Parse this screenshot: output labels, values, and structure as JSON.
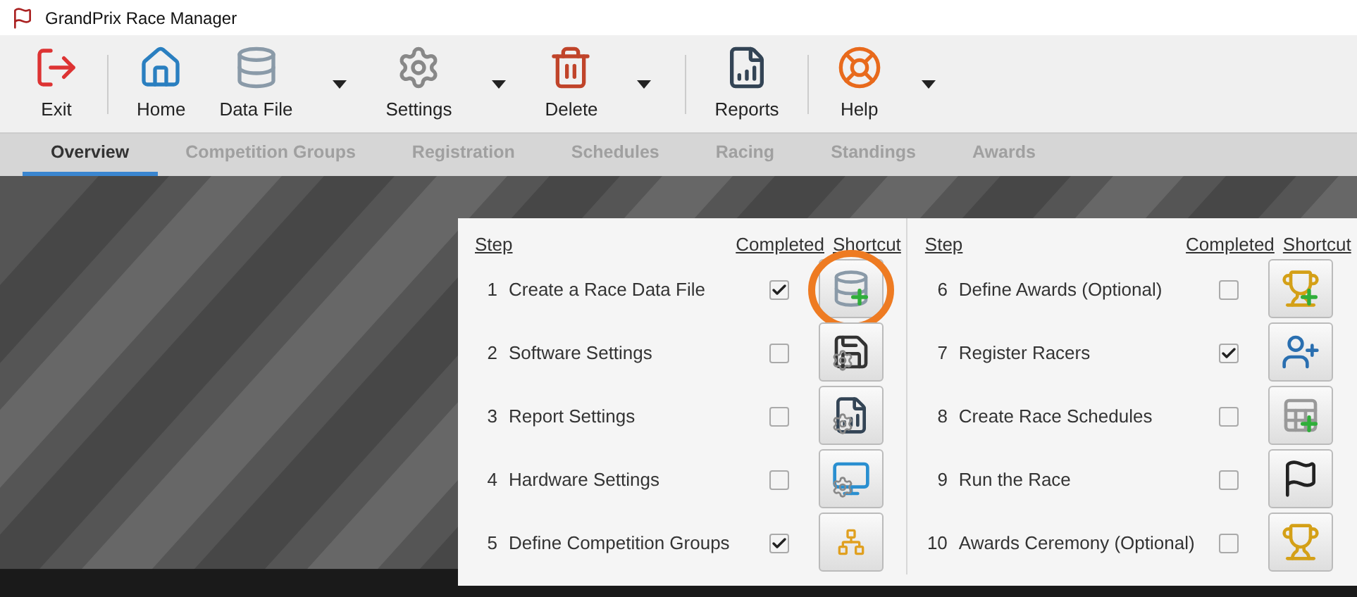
{
  "window": {
    "title": "GrandPrix Race Manager"
  },
  "toolbar": [
    {
      "label": "Exit",
      "dropdown": false,
      "separator_after": true
    },
    {
      "label": "Home",
      "dropdown": false,
      "separator_after": false
    },
    {
      "label": "Data File",
      "dropdown": true,
      "separator_after": false
    },
    {
      "label": "Settings",
      "dropdown": true,
      "separator_after": false
    },
    {
      "label": "Delete",
      "dropdown": true,
      "separator_after": true
    },
    {
      "label": "Reports",
      "dropdown": false,
      "separator_after": true
    },
    {
      "label": "Help",
      "dropdown": true,
      "separator_after": false
    }
  ],
  "tabs": [
    {
      "label": "Overview",
      "selected": true,
      "disabled": false
    },
    {
      "label": "Competition Groups",
      "selected": false,
      "disabled": true
    },
    {
      "label": "Registration",
      "selected": false,
      "disabled": true
    },
    {
      "label": "Schedules",
      "selected": false,
      "disabled": true
    },
    {
      "label": "Racing",
      "selected": false,
      "disabled": true
    },
    {
      "label": "Standings",
      "selected": false,
      "disabled": true
    },
    {
      "label": "Awards",
      "selected": false,
      "disabled": true
    }
  ],
  "steps_panel": {
    "columns": [
      {
        "headers": {
          "step": "Step",
          "completed": "Completed",
          "shortcut": "Shortcut"
        },
        "steps": [
          {
            "number": "1",
            "label": "Create a Race Data File",
            "completed": true,
            "highlighted": true
          },
          {
            "number": "2",
            "label": "Software Settings",
            "completed": false,
            "highlighted": false
          },
          {
            "number": "3",
            "label": "Report Settings",
            "completed": false,
            "highlighted": false
          },
          {
            "number": "4",
            "label": "Hardware Settings",
            "completed": false,
            "highlighted": false
          },
          {
            "number": "5",
            "label": "Define Competition Groups",
            "completed": true,
            "highlighted": false
          }
        ]
      },
      {
        "headers": {
          "step": "Step",
          "completed": "Completed",
          "shortcut": "Shortcut"
        },
        "steps": [
          {
            "number": "6",
            "label": "Define Awards (Optional)",
            "completed": false,
            "highlighted": false
          },
          {
            "number": "7",
            "label": "Register Racers",
            "completed": true,
            "highlighted": false
          },
          {
            "number": "8",
            "label": "Create Race Schedules",
            "completed": false,
            "highlighted": false
          },
          {
            "number": "9",
            "label": "Run the Race",
            "completed": false,
            "highlighted": false
          },
          {
            "number": "10",
            "label": "Awards Ceremony (Optional)",
            "completed": false,
            "highlighted": false
          }
        ]
      }
    ]
  }
}
